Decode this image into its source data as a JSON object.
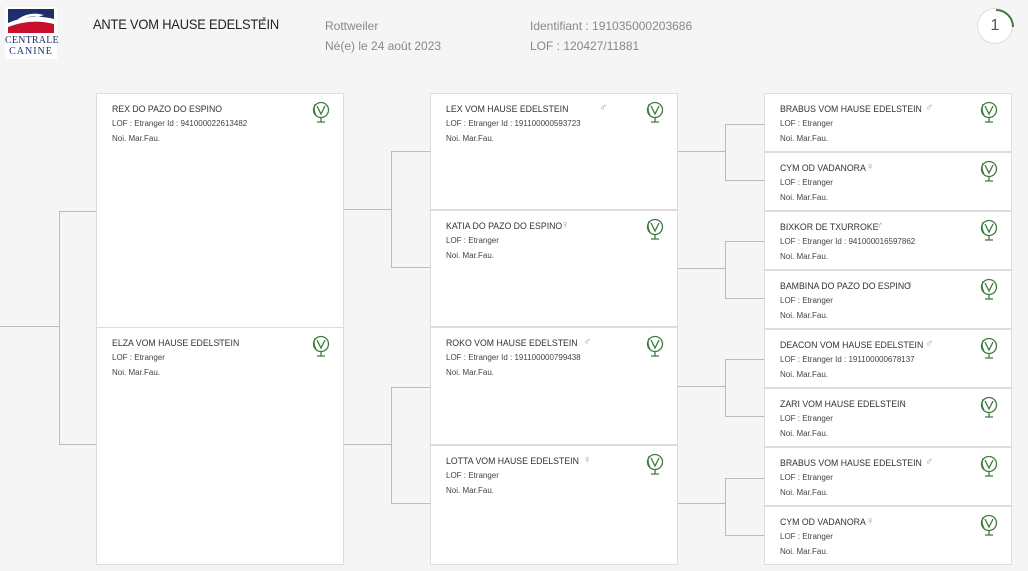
{
  "logo": {
    "line1": "CENTRALE",
    "line2": "CANINE"
  },
  "dog": {
    "name": "ANTE VOM HAUSE EDELSTEIN",
    "sex": "♂",
    "breed": "Rottweiler",
    "birth": "Né(e) le 24 août 2023",
    "identifiant": "Identifiant : 191035000203686",
    "lof": "LOF : 120427/11881"
  },
  "generation": "1",
  "ancestors": [
    {
      "name": "REX DO PAZO DO ESPINO",
      "sex": "♂",
      "line2": "LOF : Etranger   Id : 941000022613482",
      "line3": "Noi. Mar.Fau."
    },
    {
      "name": "ELZA VOM HAUSE EDELSTEIN",
      "sex": "♀",
      "line2": "LOF : Etranger",
      "line3": "Noi. Mar.Fau."
    },
    {
      "name": "LEX VOM HAUSE EDELSTEIN",
      "sex": "♂",
      "line2": "LOF : Etranger   Id : 191100000593723",
      "line3": "Noi. Mar.Fau."
    },
    {
      "name": "KATIA DO PAZO DO ESPINO",
      "sex": "♀",
      "line2": "LOF : Etranger",
      "line3": "Noi. Mar.Fau."
    },
    {
      "name": "ROKO VOM HAUSE EDELSTEIN",
      "sex": "♂",
      "line2": "LOF : Etranger   Id : 191100000799438",
      "line3": "Noi. Mar.Fau."
    },
    {
      "name": "LOTTA VOM HAUSE EDELSTEIN",
      "sex": "♀",
      "line2": "LOF : Etranger",
      "line3": "Noi. Mar.Fau."
    },
    {
      "name": "BRABUS VOM HAUSE EDELSTEIN",
      "sex": "♂",
      "line2": "LOF : Etranger",
      "line3": "Noi. Mar.Fau."
    },
    {
      "name": "CYM OD VADANORA",
      "sex": "♀",
      "line2": "LOF : Etranger",
      "line3": "Noi. Mar.Fau."
    },
    {
      "name": "BIXKOR DE TXURROKE",
      "sex": "♂",
      "line2": "LOF : Etranger   Id : 941000016597862",
      "line3": "Noi. Mar.Fau."
    },
    {
      "name": "BAMBINA DO PAZO DO ESPINO",
      "sex": "♀",
      "line2": "LOF : Etranger",
      "line3": "Noi. Mar.Fau."
    },
    {
      "name": "DEACON VOM HAUSE EDELSTEIN",
      "sex": "♂",
      "line2": "LOF : Etranger   Id : 191100000678137",
      "line3": "Noi. Mar.Fau."
    },
    {
      "name": "ZARI VOM HAUSE EDELSTEIN",
      "sex": "♀",
      "line2": "LOF : Etranger",
      "line3": "Noi. Mar.Fau."
    },
    {
      "name": "BRABUS VOM HAUSE EDELSTEIN",
      "sex": "♂",
      "line2": "LOF : Etranger",
      "line3": "Noi. Mar.Fau."
    },
    {
      "name": "CYM OD VADANORA",
      "sex": "♀",
      "line2": "LOF : Etranger",
      "line3": "Noi. Mar.Fau."
    }
  ],
  "colors": {
    "icon": "#3f7a3f",
    "brand_blue": "#1d2f6b",
    "brand_red": "#c8102e"
  }
}
